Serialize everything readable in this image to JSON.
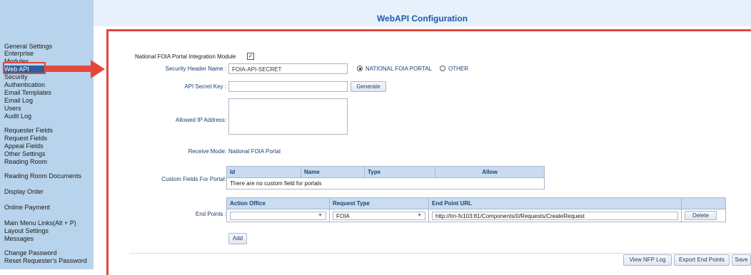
{
  "sidebar": {
    "items": [
      "General Settings",
      "Enterprise",
      "Modules",
      "Web API",
      "Security",
      "Authentication",
      "Email Templates",
      "Email Log",
      "Users",
      "Audit Log",
      "Requester Fields",
      "Request Fields",
      "Appeal Fields",
      "Other Settings",
      "Reading Room",
      "Reading Room Documents",
      "Display Order",
      "Online Payment",
      "Main Menu Links(Alt + P)",
      "Layout Settings",
      "Messages",
      "Change Password",
      "Reset Requester's Password"
    ],
    "selected": "Web API"
  },
  "page_title": "WebAPI Configuration",
  "form": {
    "module_label": "National FOIA Portal Integration Module",
    "module_checked": "✓",
    "security_header_label": "Security Header Name :",
    "security_header_value": "FOIA-API-SECRET",
    "radio_nfp_label": "NATIONAL FOIA PORTAL",
    "radio_other_label": "OTHER",
    "api_secret_label": "API Secret Key :",
    "api_secret_value": "",
    "generate_label": "Generate",
    "allowed_ip_label": "Allowed IP Address:",
    "receive_mode_label": "Receive Mode:",
    "receive_mode_value": "National FOIA Portal",
    "custom_fields_label": "Custom Fields For Portal:",
    "custom_fields_headers": [
      "Id",
      "Name",
      "Type",
      "Allow"
    ],
    "custom_fields_empty": "There are no custom field for portals",
    "endpoints_label": "End Points :",
    "endpoints_headers": [
      "Action Office",
      "Request Type",
      "End Point URL",
      ""
    ],
    "endpoint_row": {
      "action_office": "",
      "request_type": "FOIA",
      "url": "http://trn-fx103:81/Components/0/Requests/CreateRequest",
      "delete_label": "Delete"
    },
    "add_label": "Add"
  },
  "footer_buttons": {
    "view_nfp_log": "View NFP Log",
    "export_end_points": "Export End Points",
    "save": "Save"
  },
  "colors": {
    "sidebar_bg": "#b8d4ec",
    "selected_bg": "#2d5f99",
    "title_color": "#1a5aa8",
    "annotation_red": "#e5473d"
  }
}
